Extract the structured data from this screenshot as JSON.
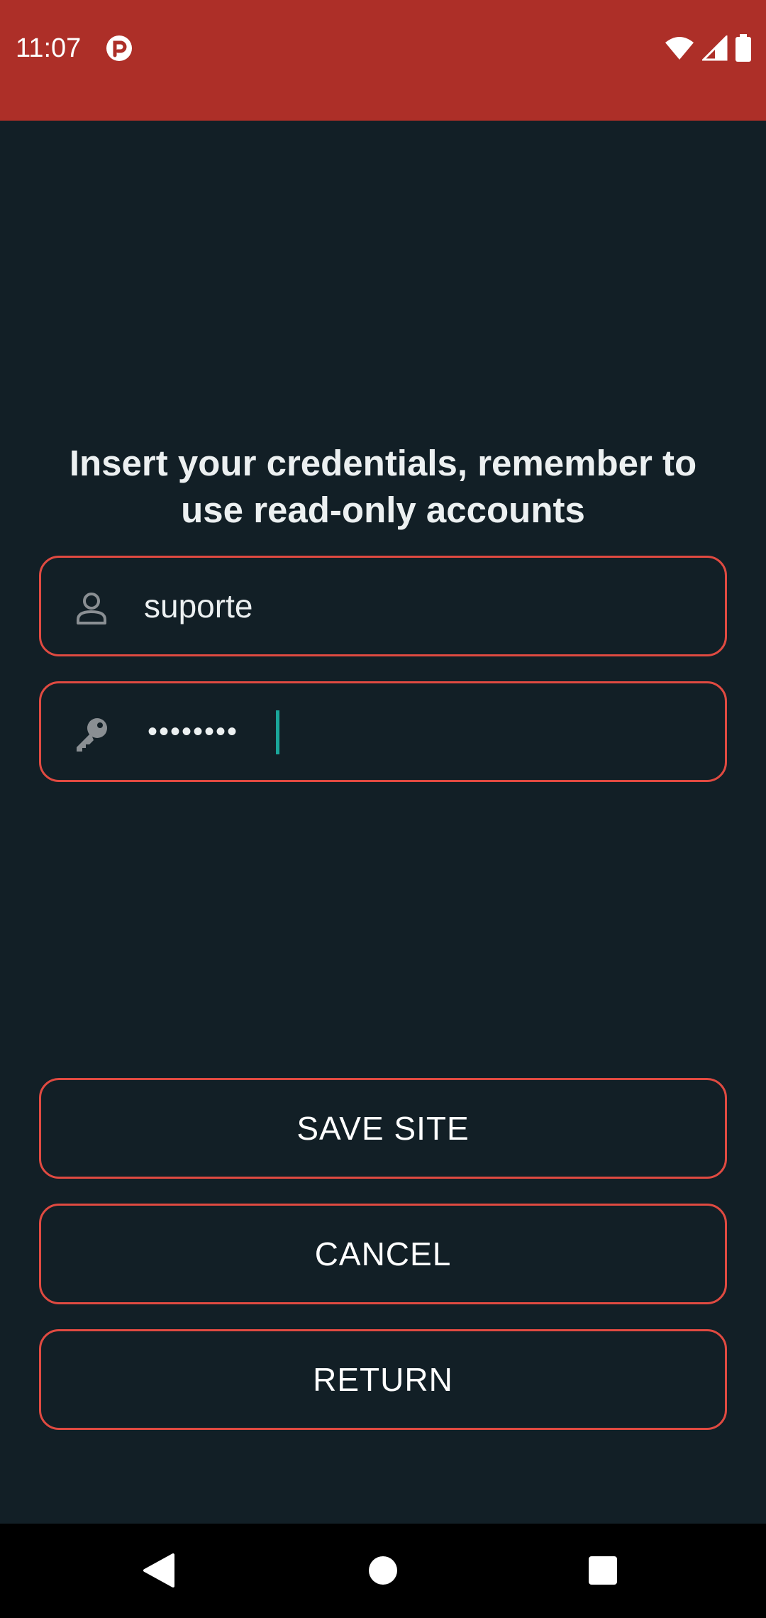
{
  "status_bar": {
    "time": "11:07",
    "background_color": "#ad2f28",
    "icons": [
      "app-notification-icon",
      "wifi-icon",
      "cell-signal-icon",
      "battery-icon"
    ]
  },
  "form": {
    "instruction": "Insert your credentials, remember to use read-only accounts",
    "username": {
      "icon": "user-icon",
      "value": "suporte"
    },
    "password": {
      "icon": "key-icon",
      "value": "••••••••"
    }
  },
  "buttons": {
    "save_site": "SAVE SITE",
    "cancel": "CANCEL",
    "return": "RETURN"
  },
  "navigation": {
    "icons": [
      "back-icon",
      "home-icon",
      "recents-icon"
    ]
  },
  "colors": {
    "background": "#121f26",
    "accent_border": "#e04a41",
    "cursor": "#1aa69a"
  }
}
